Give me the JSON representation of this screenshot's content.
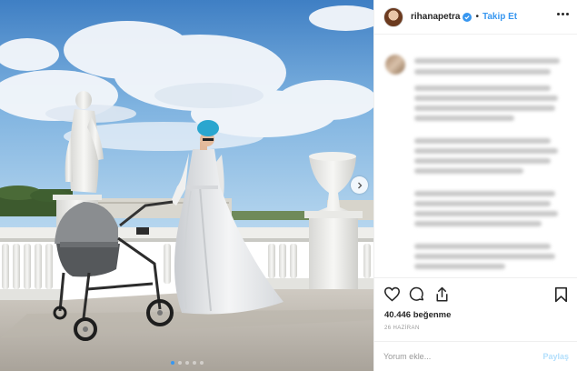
{
  "post": {
    "username": "rihanapetra",
    "follow_label": "Takip Et",
    "separator": "•",
    "likes": "40.446 beğenme",
    "date": "26 HAZİRAN",
    "comment_placeholder": "Yorum ekle...",
    "post_label": "Paylaş"
  },
  "carousel": {
    "slide_count": 5,
    "active_slide": 1
  },
  "icons": {
    "verified": "verified-badge-icon",
    "more": "more-options-icon",
    "like": "heart-icon",
    "comment": "comment-bubble-icon",
    "share": "share-icon",
    "save": "bookmark-icon",
    "next": "chevron-right-icon"
  },
  "colors": {
    "accent": "#3897f0",
    "text": "#262626",
    "muted": "#999999",
    "post_disabled": "#b2dffc",
    "border": "#efefef"
  }
}
